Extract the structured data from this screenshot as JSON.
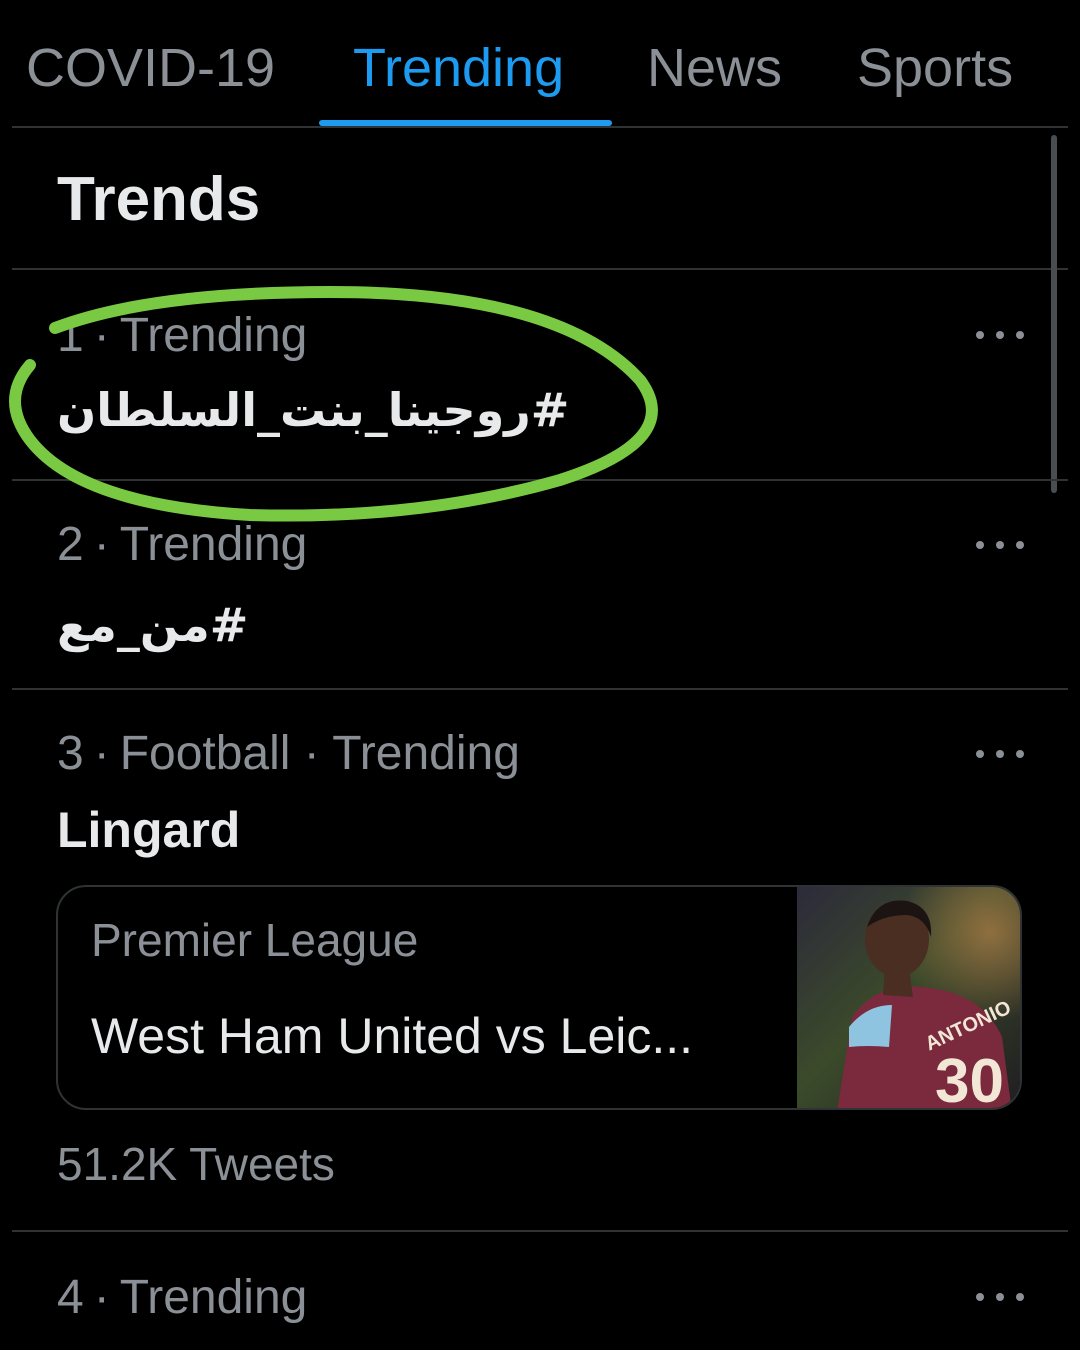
{
  "tabs": [
    {
      "label": "COVID-19",
      "active": false
    },
    {
      "label": "Trending",
      "active": true
    },
    {
      "label": "News",
      "active": false
    },
    {
      "label": "Sports",
      "active": false
    }
  ],
  "section_title": "Trends",
  "trends": [
    {
      "rank": "1",
      "meta": "Trending",
      "name": "#روجينا_بنت_السلطان"
    },
    {
      "rank": "2",
      "meta": "Trending",
      "name": "#من_مع"
    },
    {
      "rank": "3",
      "meta": "Football · Trending",
      "name": "Lingard",
      "card": {
        "league": "Premier League",
        "headline": "West Ham United vs Leic..."
      },
      "tweet_count": "51.2K Tweets"
    },
    {
      "rank": "4",
      "meta": "Trending"
    }
  ],
  "colors": {
    "background": "#000000",
    "accent": "#1d9bf0",
    "muted_text": "#8b9096",
    "primary_text": "#e7e9ea",
    "divider": "#2f3336",
    "annotation_circle": "#7ac943"
  },
  "icons": {
    "more": "more-horizontal-icon"
  }
}
